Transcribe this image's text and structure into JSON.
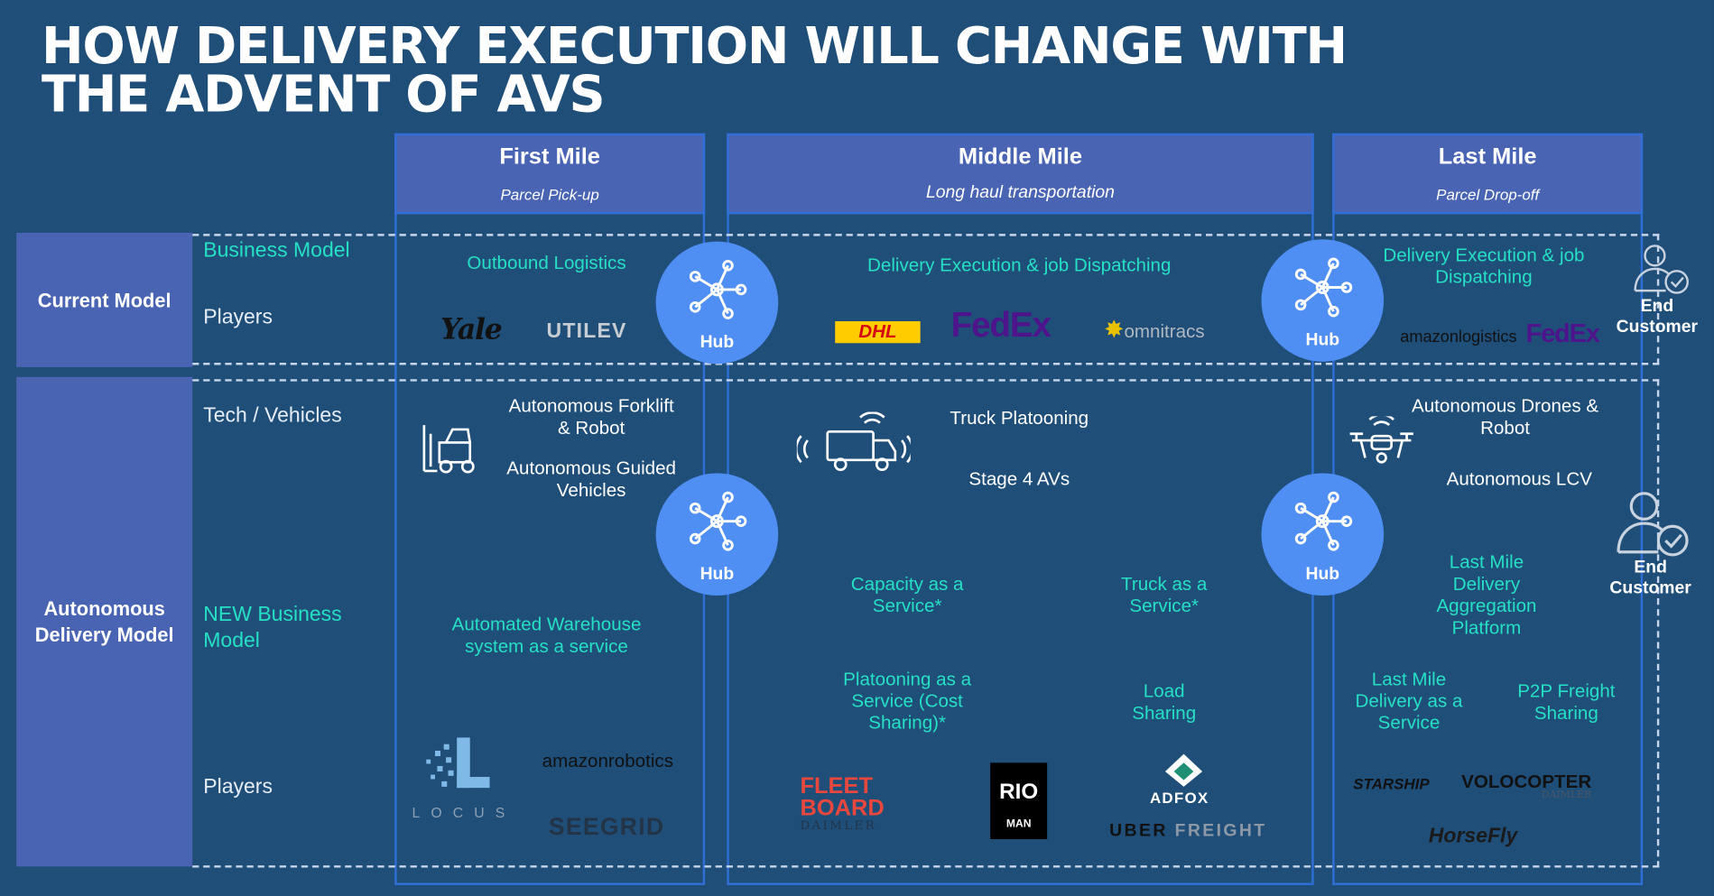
{
  "title": {
    "line1": "HOW DELIVERY EXECUTION WILL CHANGE WITH",
    "line2": "THE ADVENT OF AVS"
  },
  "columns": [
    {
      "header": "First Mile",
      "subheader": "Parcel Pick-up"
    },
    {
      "header": "Middle Mile",
      "subheader": "Long haul transportation"
    },
    {
      "header": "Last Mile",
      "subheader": "Parcel Drop-off"
    }
  ],
  "rows": {
    "current": "Current Model",
    "autonomous": "Autonomous Delivery Model"
  },
  "row_labels": {
    "business_model": "Business Model",
    "players": "Players",
    "tech_vehicles": "Tech / Vehicles",
    "new_business_model": "NEW Business Model",
    "players2": "Players"
  },
  "hub_label": "Hub",
  "end_customer": "End Customer",
  "current": {
    "first_mile": "Outbound Logistics",
    "middle_mile": "Delivery Execution & job Dispatching",
    "last_mile": "Delivery Execution & job Dispatching"
  },
  "tech": {
    "first_1": "Autonomous Forklift & Robot",
    "first_2": "Autonomous Guided Vehicles",
    "middle_1": "Truck Platooning",
    "middle_2": "Stage 4 AVs",
    "last_1": "Autonomous Drones & Robot",
    "last_2": "Autonomous LCV"
  },
  "new_models": {
    "first": "Automated Warehouse system as a service",
    "middle_capacity": "Capacity as a Service*",
    "middle_truck": "Truck as a Service*",
    "middle_platooning": "Platooning as a Service (Cost Sharing)*",
    "middle_load": "Load Sharing",
    "last_aggregation": "Last Mile Delivery Aggregation Platform",
    "last_delivery": "Last Mile Delivery as a Service",
    "last_p2p": "P2P Freight Sharing"
  },
  "logos": {
    "yale": "Yale",
    "utilev": "UTILEV",
    "dhl": "DHL",
    "fedex": "FedEx",
    "omnitracs": "omnitracs",
    "amazon_logistics": "amazonlogistics",
    "fedex2": "FedEx",
    "locus": "LOCUS",
    "amazon_robotics": "amazonrobotics",
    "seegrid": "SEEGRID",
    "fleetboard_1": "FLEET",
    "fleetboard_2": "BOARD",
    "fleetboard_3": "DAIMLER",
    "rio": "RIO",
    "man": "MAN",
    "adfox": "ADFOX",
    "uber_freight_1": "UBER",
    "uber_freight_2": "FREIGHT",
    "starship": "STARSHIP",
    "volocopter": "VOLOCOPTER",
    "volocopter_sub": "DAIMLER",
    "horsefly": "HorseFly"
  },
  "colors": {
    "background": "#1f4e79",
    "header": "#4a64b4",
    "border": "#2f6fd6",
    "hub": "#4f8ef2",
    "teal": "#26e0c4"
  },
  "icons": [
    "hub-network-icon",
    "forklift-icon",
    "connected-truck-icon",
    "drone-icon",
    "user-check-icon"
  ]
}
